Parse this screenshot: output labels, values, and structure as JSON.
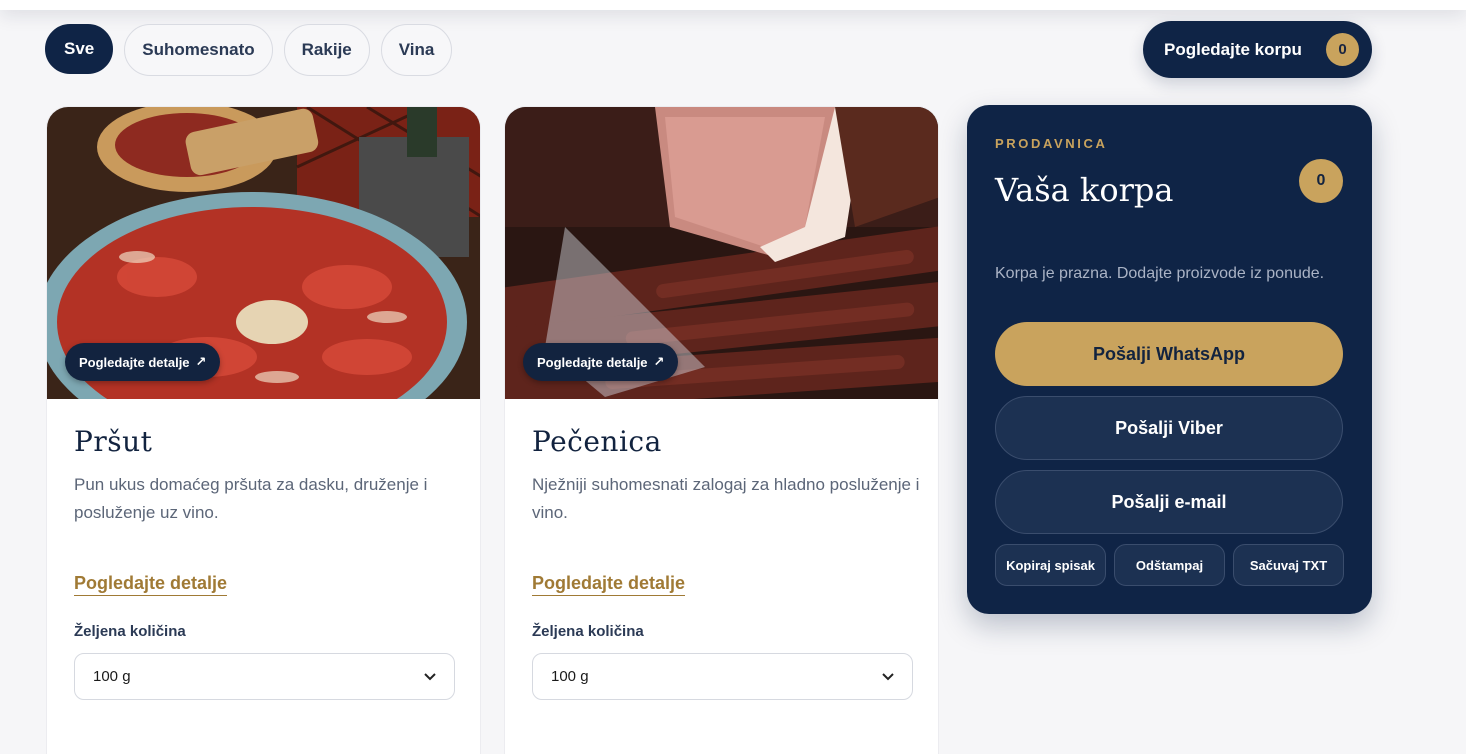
{
  "filters": {
    "items": [
      {
        "label": "Sve",
        "active": true
      },
      {
        "label": "Suhomesnato",
        "active": false
      },
      {
        "label": "Rakije",
        "active": false
      },
      {
        "label": "Vina",
        "active": false
      }
    ]
  },
  "header": {
    "cart_button_label": "Pogledajte korpu",
    "cart_count": "0"
  },
  "products": [
    {
      "image_chip_label": "Pogledajte detalje",
      "image_chip_icon": "arrow-up-right-icon",
      "name": "Pršut",
      "description": "Pun ukus domaćeg pršuta za dasku, druženje i posluženje uz vino.",
      "details_link": "Pogledajte detalje",
      "quantity_label": "Željena količina",
      "quantity_value": "100 g"
    },
    {
      "image_chip_label": "Pogledajte detalje",
      "image_chip_icon": "arrow-up-right-icon",
      "name": "Pečenica",
      "description": "Nježniji suhomesnati zalogaj za hladno posluženje i vino.",
      "details_link": "Pogledajte detalje",
      "quantity_label": "Željena količina",
      "quantity_value": "100 g"
    }
  ],
  "cart_panel": {
    "kicker": "PRODAVNICA",
    "title": "Vaša korpa",
    "count": "0",
    "empty_text": "Korpa je prazna. Dodajte proizvode iz ponude.",
    "whatsapp_label": "Pošalji WhatsApp",
    "viber_label": "Pošalji Viber",
    "email_label": "Pošalji e-mail",
    "copy_label": "Kopiraj spisak",
    "print_label": "Odštampaj",
    "save_label": "Sačuvaj TXT"
  },
  "colors": {
    "navy": "#0f2446",
    "gold": "#c9a35d",
    "link_gold": "#a07a35"
  }
}
